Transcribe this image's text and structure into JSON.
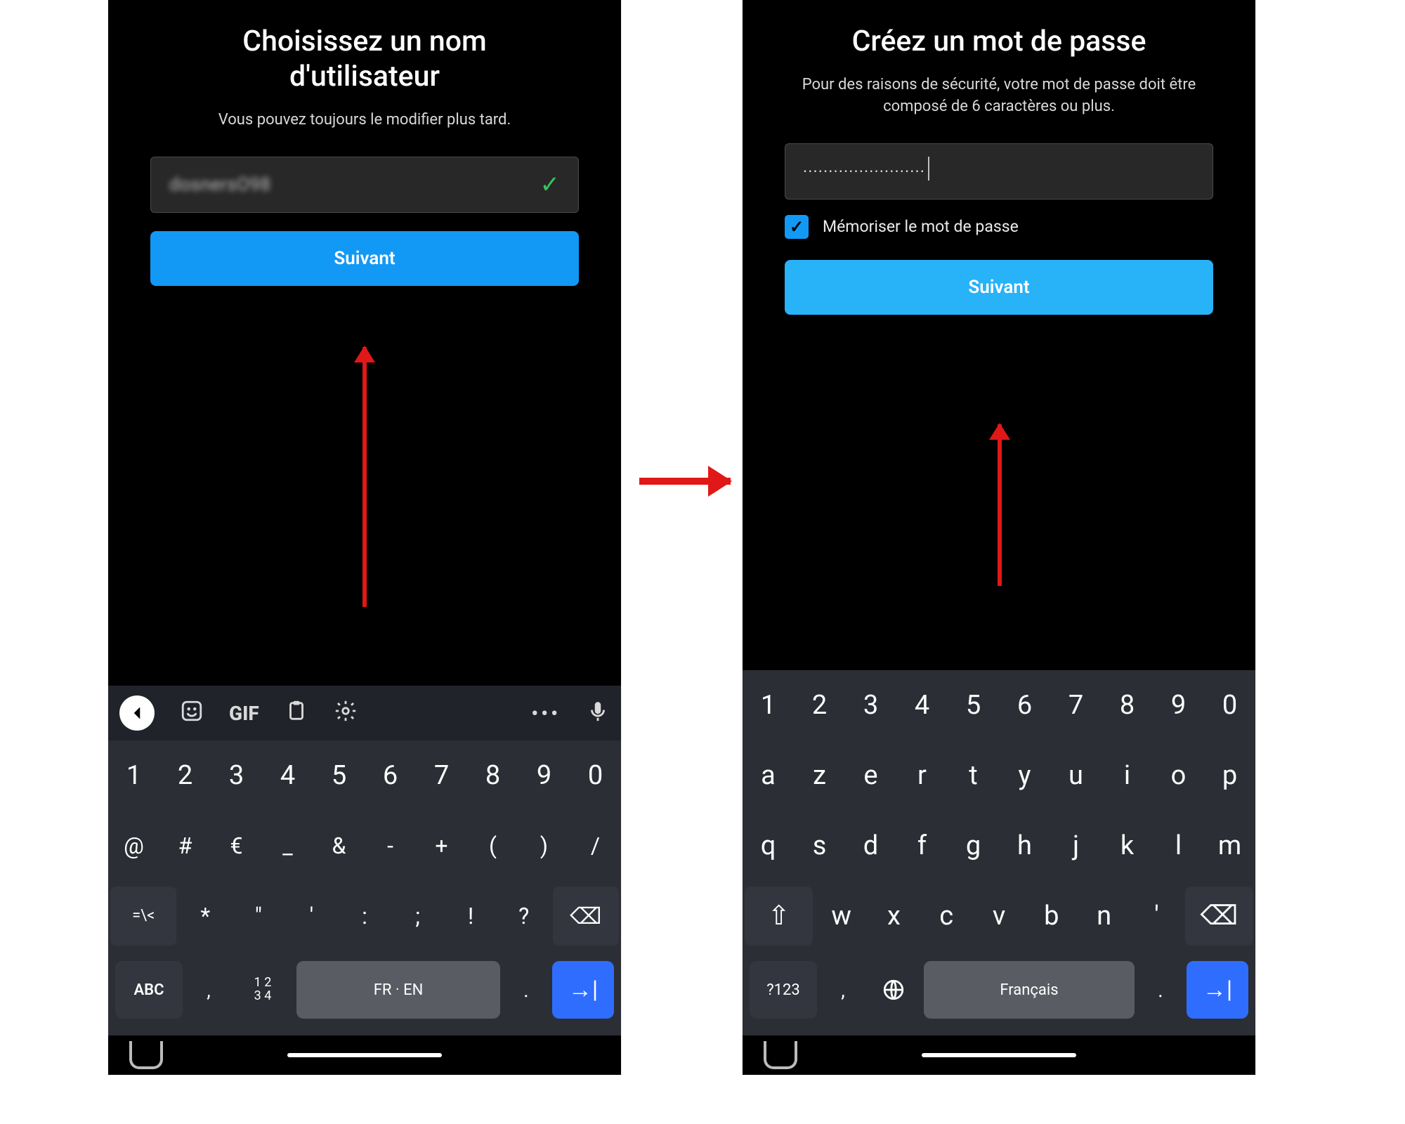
{
  "left": {
    "title_line1": "Choisissez un nom",
    "title_line2": "d'utilisateur",
    "subtitle": "Vous pouvez toujours le modifier plus tard.",
    "username_value": "dosnersO98",
    "check": "✓",
    "button": "Suivant",
    "toolbar": {
      "gif": "GIF"
    },
    "rows": {
      "r1": [
        "1",
        "2",
        "3",
        "4",
        "5",
        "6",
        "7",
        "8",
        "9",
        "0"
      ],
      "r2": [
        "@",
        "#",
        "€",
        "_",
        "&",
        "-",
        "+",
        "(",
        ")",
        "/"
      ],
      "r3_shift": "=\\<",
      "r3": [
        "*",
        "\"",
        "'",
        ":",
        ";",
        "!",
        "?"
      ],
      "r3_back": "⌫"
    },
    "bottom": {
      "abc": "ABC",
      "nums1": "1 2",
      "nums2": "3 4",
      "space": "FR · EN",
      "enter": "→|"
    }
  },
  "right": {
    "title": "Créez un mot de passe",
    "subtitle": "Pour des raisons de sécurité, votre mot de passe doit être composé de 6 caractères ou plus.",
    "password_dots_count": 24,
    "remember_label": "Mémoriser le mot de passe",
    "button": "Suivant",
    "rows": {
      "r1": [
        "1",
        "2",
        "3",
        "4",
        "5",
        "6",
        "7",
        "8",
        "9",
        "0"
      ],
      "r2": [
        "a",
        "z",
        "e",
        "r",
        "t",
        "y",
        "u",
        "i",
        "o",
        "p"
      ],
      "r3": [
        "q",
        "s",
        "d",
        "f",
        "g",
        "h",
        "j",
        "k",
        "l",
        "m"
      ],
      "r4_shift": "⇧",
      "r4": [
        "w",
        "x",
        "c",
        "v",
        "b",
        "n",
        "'"
      ],
      "r4_back": "⌫"
    },
    "bottom": {
      "q123": "?123",
      "space": "Français",
      "enter": "→|"
    }
  },
  "colors": {
    "accent": "#1299f6",
    "accent2": "#28b2f8",
    "arrow": "#e01818",
    "check": "#36c559"
  }
}
